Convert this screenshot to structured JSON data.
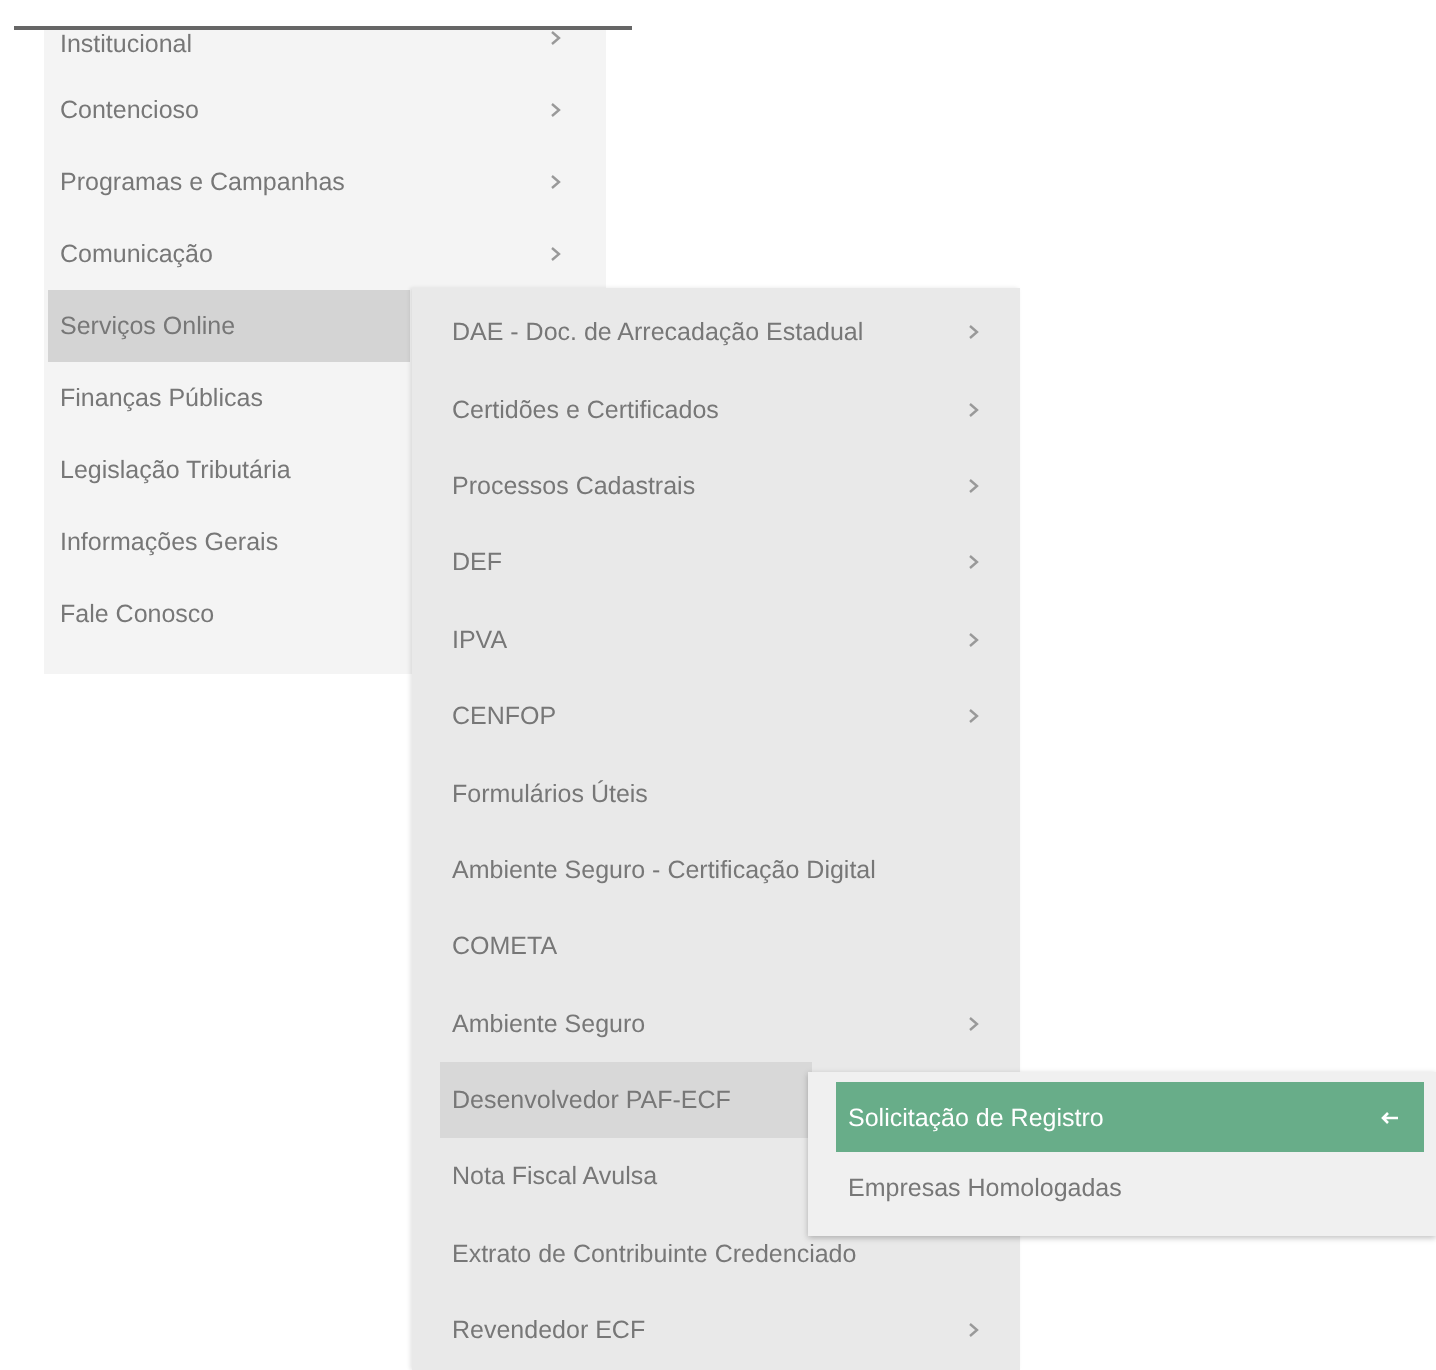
{
  "menu": {
    "items": [
      {
        "label": "Institucional",
        "has_submenu": true,
        "selected": false
      },
      {
        "label": "Contencioso",
        "has_submenu": true,
        "selected": false
      },
      {
        "label": "Programas e Campanhas",
        "has_submenu": true,
        "selected": false
      },
      {
        "label": "Comunicação",
        "has_submenu": true,
        "selected": false
      },
      {
        "label": "Serviços Online",
        "selected": true
      },
      {
        "label": "Finanças Públicas",
        "selected": false
      },
      {
        "label": "Legislação Tributária",
        "selected": false
      },
      {
        "label": "Informações Gerais",
        "selected": false
      },
      {
        "label": "Fale Conosco",
        "selected": false
      }
    ]
  },
  "submenu": {
    "items": [
      {
        "label": "DAE - Doc. de Arrecadação Estadual",
        "has_submenu": true,
        "selected": false
      },
      {
        "label": "Certidões e Certificados",
        "has_submenu": true,
        "selected": false
      },
      {
        "label": "Processos Cadastrais",
        "has_submenu": true,
        "selected": false
      },
      {
        "label": "DEF",
        "has_submenu": true,
        "selected": false
      },
      {
        "label": "IPVA",
        "has_submenu": true,
        "selected": false
      },
      {
        "label": "CENFOP",
        "has_submenu": true,
        "selected": false
      },
      {
        "label": "Formulários Úteis",
        "has_submenu": false,
        "selected": false
      },
      {
        "label": "Ambiente Seguro - Certificação Digital",
        "has_submenu": false,
        "selected": false
      },
      {
        "label": "COMETA",
        "has_submenu": false,
        "selected": false
      },
      {
        "label": "Ambiente Seguro",
        "has_submenu": true,
        "selected": false
      },
      {
        "label": "Desenvolvedor PAF-ECF",
        "selected": true
      },
      {
        "label": "Nota Fiscal Avulsa",
        "selected": false
      },
      {
        "label": "Extrato de Contribuinte Credenciado",
        "has_submenu": false,
        "selected": false
      },
      {
        "label": "Revendedor ECF",
        "has_submenu": true,
        "selected": false
      }
    ]
  },
  "flyout": {
    "items": [
      {
        "label": "Solicitação de Registro",
        "selected": true
      },
      {
        "label": "Empresas Homologadas",
        "selected": false
      }
    ]
  }
}
